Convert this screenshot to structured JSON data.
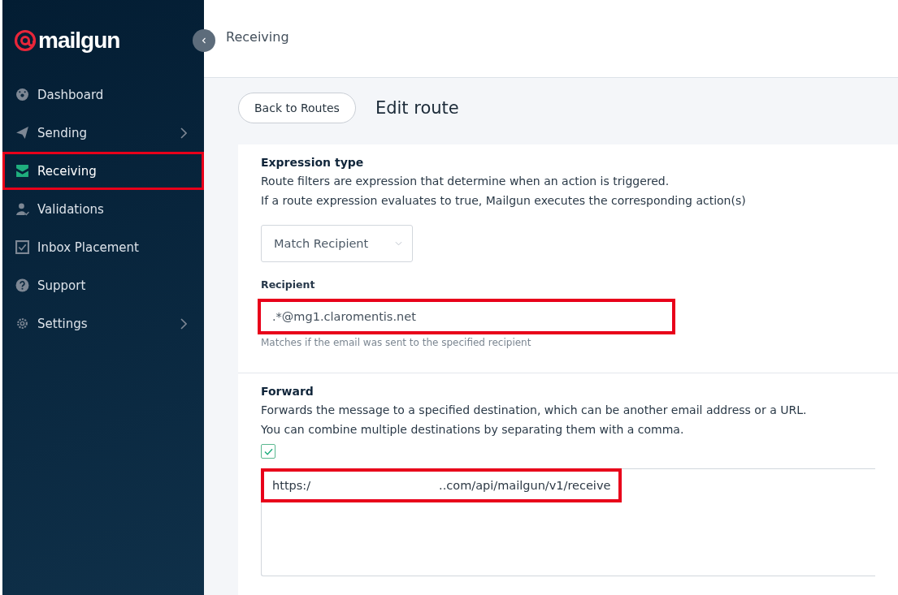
{
  "sidebar": {
    "logo": "mailgun",
    "items": [
      {
        "label": "Dashboard",
        "selected": false,
        "highlighted": false,
        "has_submenu": false
      },
      {
        "label": "Sending",
        "selected": false,
        "highlighted": false,
        "has_submenu": true
      },
      {
        "label": "Receiving",
        "selected": true,
        "highlighted": true,
        "has_submenu": false
      },
      {
        "label": "Validations",
        "selected": false,
        "highlighted": false,
        "has_submenu": false
      },
      {
        "label": "Inbox Placement",
        "selected": false,
        "highlighted": false,
        "has_submenu": false
      },
      {
        "label": "Support",
        "selected": false,
        "highlighted": false,
        "has_submenu": false
      },
      {
        "label": "Settings",
        "selected": false,
        "highlighted": false,
        "has_submenu": true
      }
    ]
  },
  "topbar": {
    "title": "Receiving"
  },
  "page": {
    "back_button": "Back to Routes",
    "title": "Edit route"
  },
  "expression": {
    "heading": "Expression type",
    "lines": [
      "Route filters are expression that determine when an action is triggered.",
      "If a route expression evaluates to true, Mailgun executes the corresponding action(s)"
    ],
    "select": {
      "value": "Match Recipient"
    },
    "recipient": {
      "label": "Recipient",
      "value": ".*@mg1.claromentis.net",
      "highlighted": true,
      "hint": "Matches if the email was sent to the specified recipient"
    }
  },
  "forward": {
    "heading": "Forward",
    "lines": [
      "Forwards the message to a specified destination, which can be another email address or a URL.",
      "You can combine multiple destinations by separating them with a comma."
    ],
    "checked": true,
    "destination": {
      "value_parts": [
        "https:/",
        "..com/api/mailgun/v1/receive"
      ],
      "redacted": true,
      "highlighted": true
    }
  }
}
